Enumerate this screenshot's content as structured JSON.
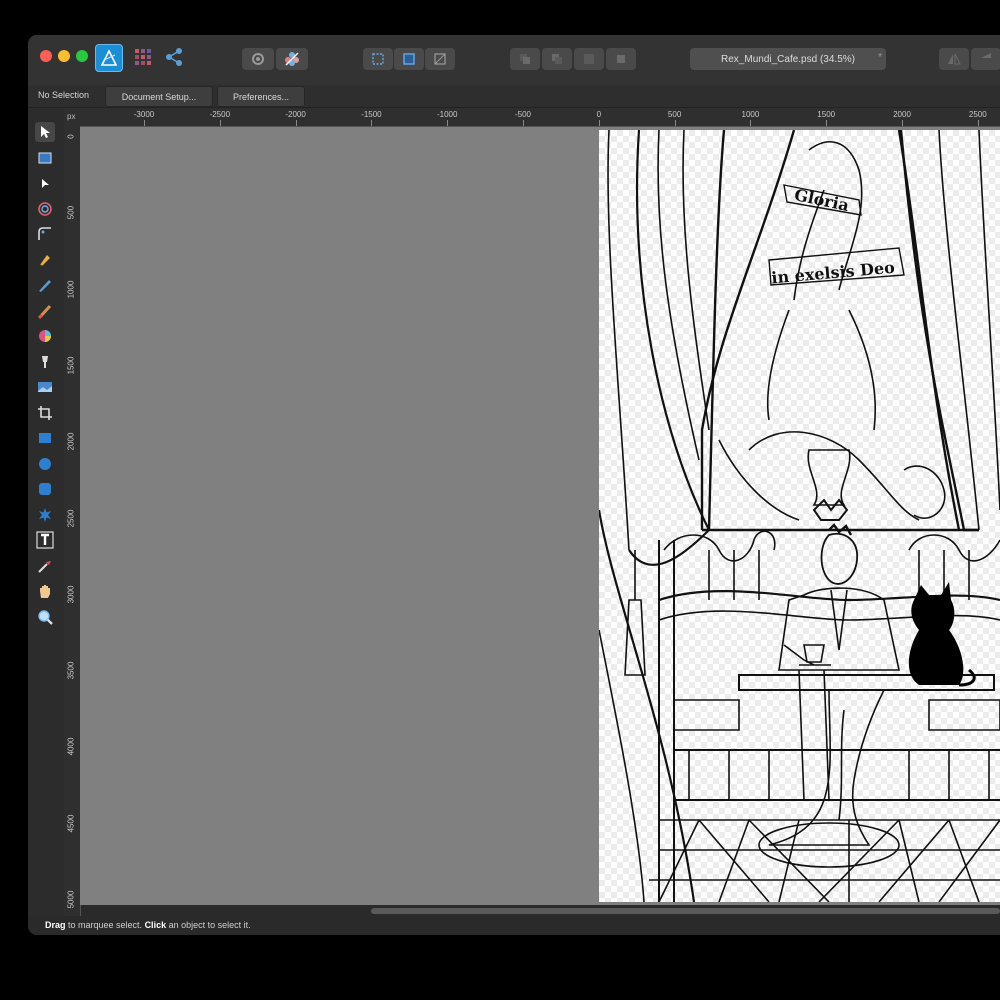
{
  "titlebar": {
    "document_name": "Rex_Mundi_Cafe.psd (34.5%)",
    "modified_marker": "*"
  },
  "context_toolbar": {
    "selection_status": "No Selection",
    "document_setup_label": "Document Setup...",
    "preferences_label": "Preferences..."
  },
  "tools": [
    {
      "name": "move-tool-icon",
      "active": true
    },
    {
      "name": "artboard-tool-icon"
    },
    {
      "name": "node-tool-icon"
    },
    {
      "name": "contour-tool-icon"
    },
    {
      "name": "corner-tool-icon"
    },
    {
      "name": "pen-tool-icon"
    },
    {
      "name": "pencil-tool-icon"
    },
    {
      "name": "vector-brush-tool-icon"
    },
    {
      "name": "fill-tool-icon"
    },
    {
      "name": "transparency-tool-icon"
    },
    {
      "name": "place-image-tool-icon"
    },
    {
      "name": "vector-crop-tool-icon"
    },
    {
      "name": "rectangle-tool-icon"
    },
    {
      "name": "ellipse-tool-icon"
    },
    {
      "name": "rounded-rectangle-tool-icon"
    },
    {
      "name": "shape-tool-icon"
    },
    {
      "name": "artistic-text-tool-icon"
    },
    {
      "name": "color-picker-tool-icon"
    },
    {
      "name": "view-tool-icon"
    },
    {
      "name": "zoom-tool-icon"
    }
  ],
  "ruler": {
    "unit": "px",
    "top_labels": [
      "-3000",
      "-2500",
      "-2000",
      "-1500",
      "-1000",
      "-500",
      "0",
      "500",
      "1000",
      "1500",
      "2000",
      "2500"
    ],
    "left_labels": [
      "0",
      "500",
      "1000",
      "1500",
      "2000",
      "2500",
      "3000",
      "3500",
      "4000",
      "4500",
      "5000"
    ]
  },
  "artwork_text": {
    "banner_top": "Gloria",
    "banner_middle": "in exelsis Deo"
  },
  "status": {
    "drag_word": "Drag",
    "drag_rest": " to marquee select. ",
    "click_word": "Click",
    "click_rest": " an object to select it."
  },
  "colors": {
    "close": "#ff5f57",
    "minimize": "#febc2e",
    "zoom": "#28c840",
    "app_icon": "#1b8fd6",
    "canvas_bg": "#808080"
  }
}
